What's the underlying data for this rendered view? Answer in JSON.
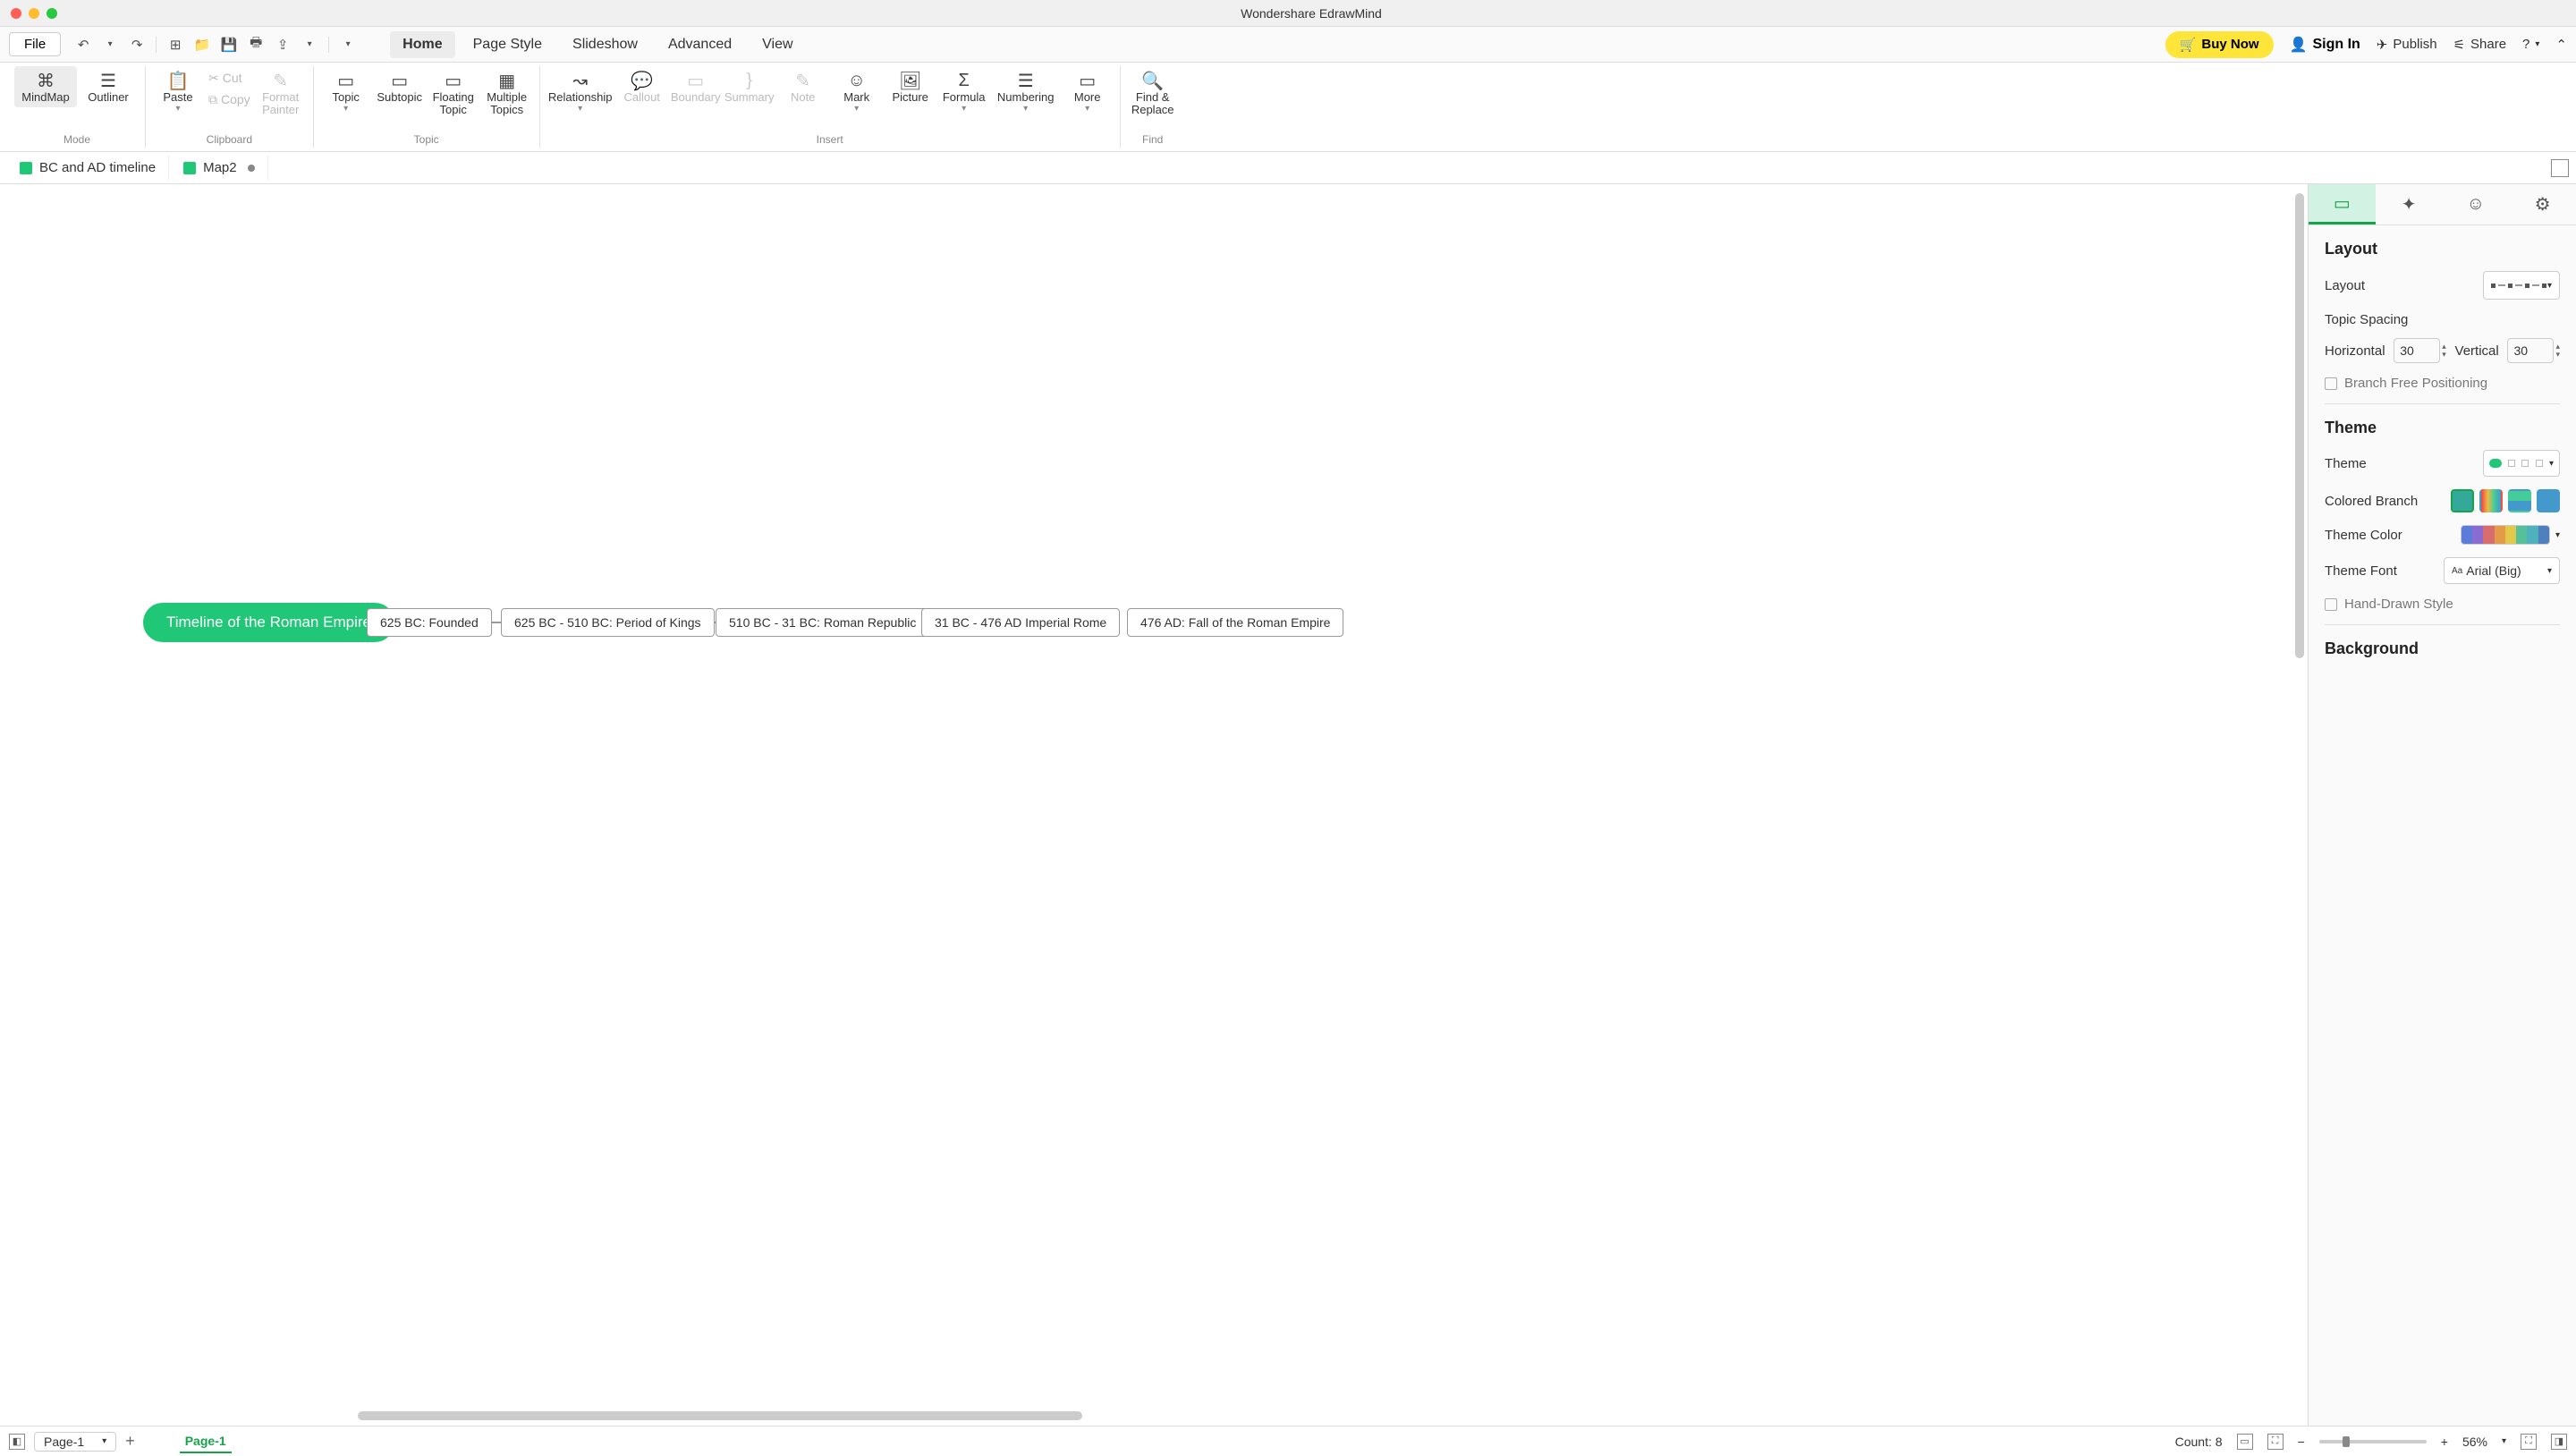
{
  "titlebar": {
    "title": "Wondershare EdrawMind"
  },
  "menubar": {
    "file": "File",
    "tabs": [
      "Home",
      "Page Style",
      "Slideshow",
      "Advanced",
      "View"
    ],
    "active_tab": 0,
    "buy": "Buy Now",
    "signin": "Sign In",
    "publish": "Publish",
    "share": "Share"
  },
  "ribbon": {
    "mode": {
      "label": "Mode",
      "mindmap": "MindMap",
      "outliner": "Outliner"
    },
    "clipboard": {
      "label": "Clipboard",
      "paste": "Paste",
      "cut": "Cut",
      "copy": "Copy",
      "format_painter_l1": "Format",
      "format_painter_l2": "Painter"
    },
    "topic": {
      "label": "Topic",
      "topic": "Topic",
      "subtopic": "Subtopic",
      "floating_l1": "Floating",
      "floating_l2": "Topic",
      "multiple_l1": "Multiple",
      "multiple_l2": "Topics"
    },
    "insert_group": {
      "label": "Insert",
      "relationship": "Relationship",
      "callout": "Callout",
      "boundary": "Boundary",
      "summary": "Summary",
      "note": "Note",
      "mark": "Mark",
      "picture": "Picture",
      "formula": "Formula",
      "numbering": "Numbering",
      "more": "More"
    },
    "find": {
      "label": "Find",
      "find_l1": "Find &",
      "find_l2": "Replace"
    }
  },
  "doctabs": {
    "tabs": [
      {
        "label": "BC and AD timeline",
        "modified": false
      },
      {
        "label": "Map2",
        "modified": true
      }
    ]
  },
  "timeline": {
    "root": "Timeline of the Roman Empire",
    "nodes": [
      "625 BC: Founded",
      "625 BC - 510 BC: Period of Kings",
      "510 BC - 31 BC: Roman Republic",
      "31 BC - 476 AD Imperial Rome",
      "476 AD: Fall of the Roman Empire"
    ]
  },
  "sidepanel": {
    "layout_h": "Layout",
    "layout_label": "Layout",
    "topic_spacing": "Topic Spacing",
    "horizontal": "Horizontal",
    "horizontal_val": "30",
    "vertical": "Vertical",
    "vertical_val": "30",
    "branch_free": "Branch Free Positioning",
    "theme_h": "Theme",
    "theme_label": "Theme",
    "colored_branch": "Colored Branch",
    "theme_color": "Theme Color",
    "theme_color_swatches": [
      "#5b7cdb",
      "#8a6bd1",
      "#d96d6d",
      "#e39a49",
      "#e3c949",
      "#56c09a",
      "#4fb1bd",
      "#4f7fbd"
    ],
    "theme_font": "Theme Font",
    "theme_font_val": "Arial (Big)",
    "hand_drawn": "Hand-Drawn Style",
    "background_h": "Background"
  },
  "statusbar": {
    "page_selector": "Page-1",
    "page_tab": "Page-1",
    "count": "Count: 8",
    "zoom": "56%"
  }
}
